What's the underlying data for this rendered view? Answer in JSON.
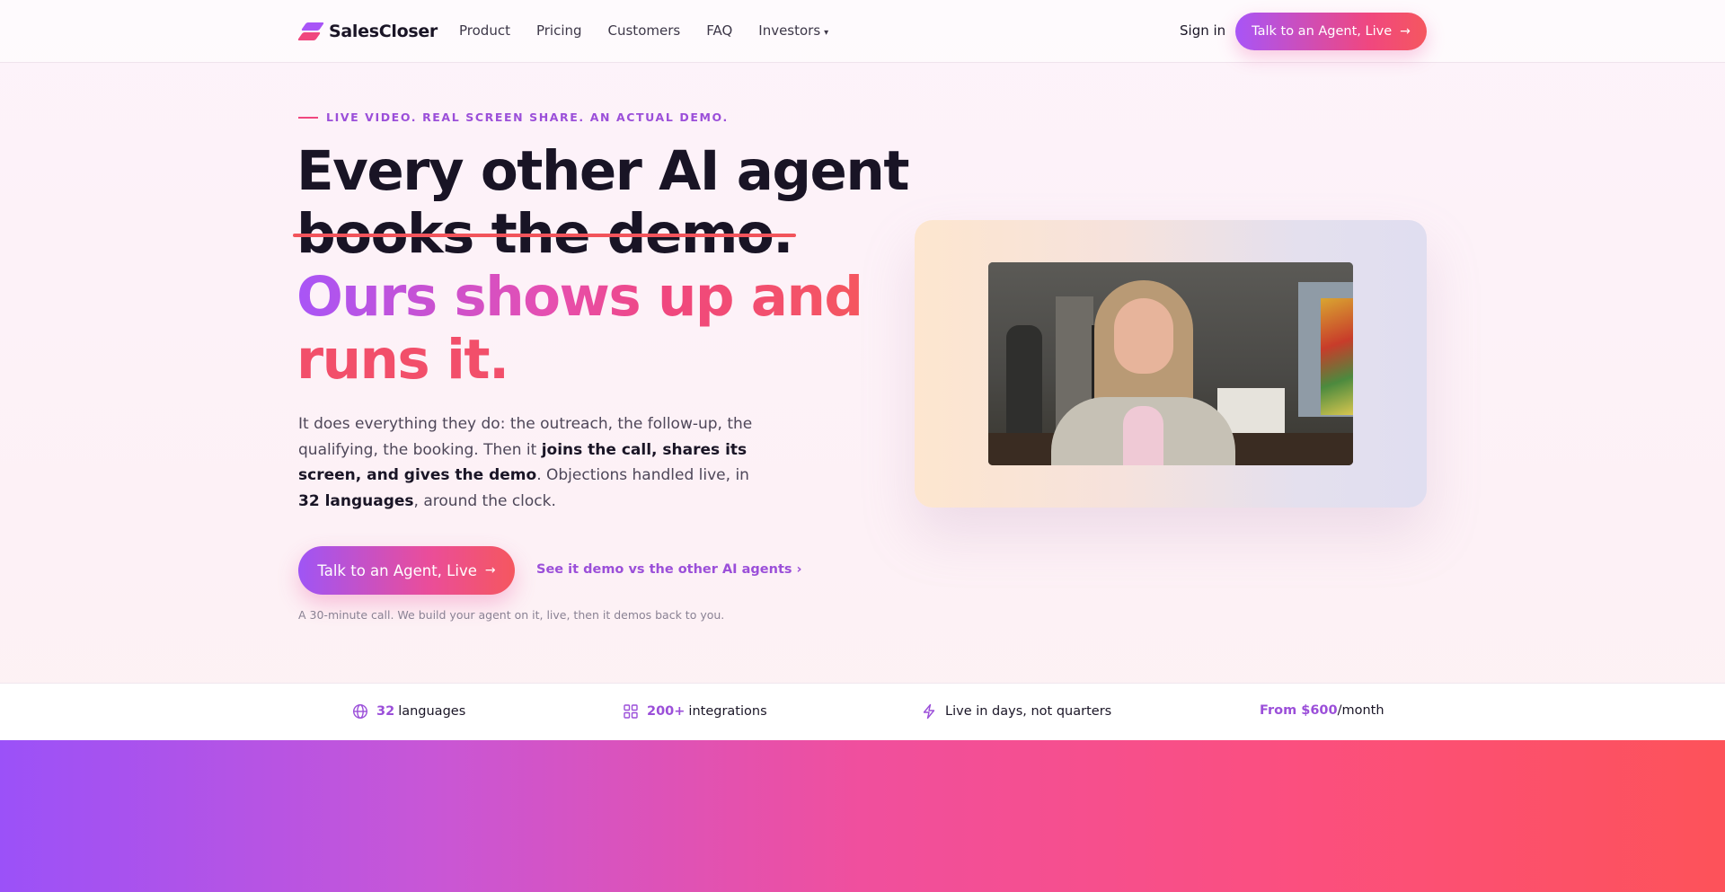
{
  "nav": {
    "brand": "SalesCloser",
    "links": [
      {
        "label": "Product"
      },
      {
        "label": "Pricing"
      },
      {
        "label": "Customers"
      },
      {
        "label": "FAQ"
      },
      {
        "label": "Investors",
        "caret": "▾"
      }
    ],
    "sign_in": "Sign in",
    "cta": "Talk to an Agent, Live",
    "cta_arrow": "→"
  },
  "hero": {
    "eyebrow": "LIVE VIDEO. REAL SCREEN SHARE. AN ACTUAL DEMO.",
    "headline_line1": "Every other AI agent",
    "headline_struck": "books the demo.",
    "headline_line3": "Ours shows up and",
    "headline_line4": "runs it.",
    "para": {
      "p1": "It does everything they do: the outreach, the follow-up, the qualifying, the booking. Then it ",
      "b1": "joins the call, shares its screen, and gives the demo",
      "p2": ". Objections handled live, in ",
      "b2": "32 languages",
      "p3": ", around the clock."
    },
    "cta": "Talk to an Agent, Live",
    "cta_arrow": "→",
    "demo_link": "See it demo vs the other AI agents ›",
    "note": "A 30-minute call. We build your agent on it, live, then it demos back to you."
  },
  "stats": [
    {
      "icon": "globe-icon",
      "highlight": "32",
      "text": "languages"
    },
    {
      "icon": "grid-icon",
      "highlight": "200+",
      "text": "integrations"
    },
    {
      "icon": "lightning-icon",
      "highlight": "",
      "text": "Live in days, not quarters"
    },
    {
      "icon": "",
      "highlight": "From $600",
      "text": "/month"
    }
  ],
  "colors": {
    "accent_purple": "#a855f7",
    "accent_pink": "#f0477f",
    "accent_coral": "#f5575f",
    "link_purple": "#9b4fd9"
  }
}
